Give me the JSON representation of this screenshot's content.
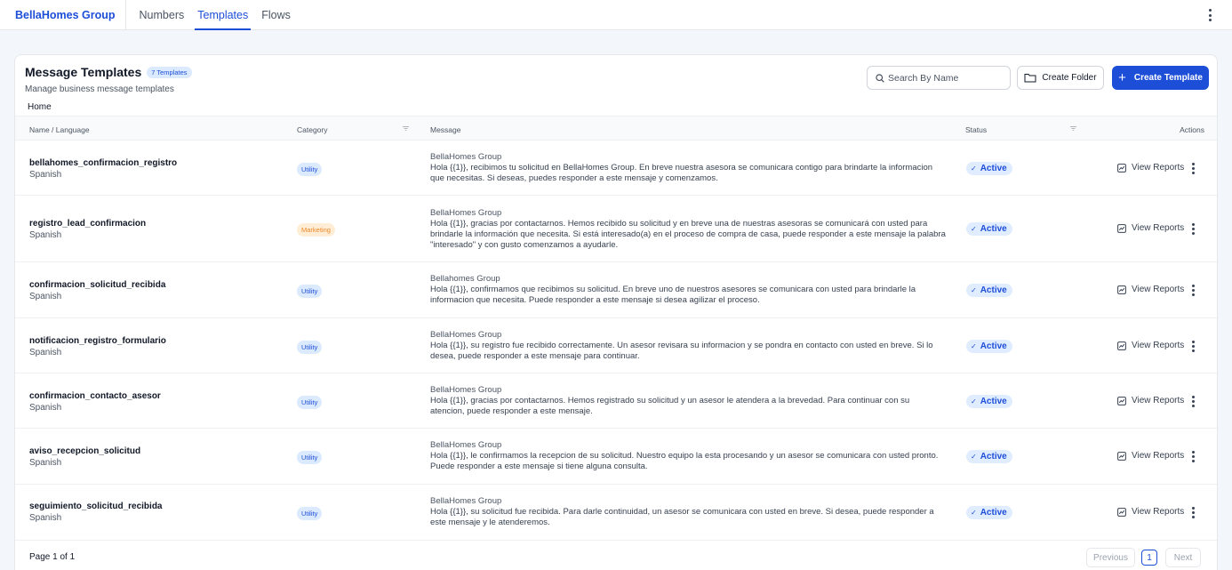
{
  "topbar": {
    "brand": "BellaHomes Group",
    "tabs": [
      {
        "label": "Numbers",
        "active": false
      },
      {
        "label": "Templates",
        "active": true
      },
      {
        "label": "Flows",
        "active": false
      }
    ]
  },
  "header": {
    "title": "Message Templates",
    "count_badge": "7 Templates",
    "subtitle": "Manage business message templates",
    "breadcrumb": "Home",
    "search_placeholder": "Search By Name",
    "create_folder_label": "Create Folder",
    "create_template_label": "Create Template"
  },
  "table": {
    "columns": {
      "name": "Name / Language",
      "category": "Category",
      "message": "Message",
      "status": "Status",
      "actions": "Actions"
    },
    "action_label": "View Reports",
    "rows": [
      {
        "name": "bellahomes_confirmacion_registro",
        "language": "Spanish",
        "category": "Utility",
        "sender": "BellaHomes Group",
        "body": "Hola {{1}}, recibimos tu solicitud en BellaHomes Group. En breve nuestra asesora se comunicara contigo para brindarte la informacion que necesitas. Si deseas, puedes responder a este mensaje y comenzamos.",
        "status": "Active"
      },
      {
        "name": "registro_lead_confirmacion",
        "language": "Spanish",
        "category": "Marketing",
        "sender": "BellaHomes Group",
        "body": "Hola {{1}}, gracias por contactarnos. Hemos recibido su solicitud y en breve una de nuestras asesoras se comunicará con usted para brindarle la información que necesita. Si está interesado(a) en el proceso de compra de casa, puede responder a este mensaje la palabra \"interesado\" y con gusto comenzamos a ayudarle.",
        "status": "Active"
      },
      {
        "name": "confirmacion_solicitud_recibida",
        "language": "Spanish",
        "category": "Utility",
        "sender": "Bellahomes Group",
        "body": "Hola {{1}}, confirmamos que recibimos su solicitud. En breve uno de nuestros asesores se comunicara con usted para brindarle la informacion que necesita. Puede responder a este mensaje si desea agilizar el proceso.",
        "status": "Active"
      },
      {
        "name": "notificacion_registro_formulario",
        "language": "Spanish",
        "category": "Utility",
        "sender": "BellaHomes Group",
        "body": "Hola {{1}}, su registro fue recibido correctamente. Un asesor revisara su informacion y se pondra en contacto con usted en breve. Si lo desea, puede responder a este mensaje para continuar.",
        "status": "Active"
      },
      {
        "name": "confirmacion_contacto_asesor",
        "language": "Spanish",
        "category": "Utility",
        "sender": "BellaHomes Group",
        "body": "Hola {{1}}, gracias por contactarnos. Hemos registrado su solicitud y un asesor le atendera a la brevedad. Para continuar con su atencion, puede responder a este mensaje.",
        "status": "Active"
      },
      {
        "name": "aviso_recepcion_solicitud",
        "language": "Spanish",
        "category": "Utility",
        "sender": "BellaHomes Group",
        "body": "Hola {{1}}, le confirmamos la recepcion de su solicitud. Nuestro equipo la esta procesando y un asesor se comunicara con usted pronto. Puede responder a este mensaje si tiene alguna consulta.",
        "status": "Active"
      },
      {
        "name": "seguimiento_solicitud_recibida",
        "language": "Spanish",
        "category": "Utility",
        "sender": "BellaHomes Group",
        "body": "Hola {{1}}, su solicitud fue recibida. Para darle continuidad, un asesor se comunicara con usted en breve. Si desea, puede responder a este mensaje y le atenderemos.",
        "status": "Active"
      }
    ]
  },
  "pagination": {
    "info": "Page 1 of 1",
    "previous": "Previous",
    "current": "1",
    "next": "Next"
  },
  "colors": {
    "accent": "#1d4ed8",
    "utility_badge_bg": "#dbeafe",
    "marketing_badge_bg": "#ffedd5",
    "marketing_badge_text": "#ea8a2c"
  },
  "icons": {
    "search": "search-icon",
    "folder": "folder-icon",
    "plus": "plus-icon",
    "check": "check-icon",
    "reports": "chart-icon",
    "more": "kebab-icon",
    "filter": "filter-icon"
  }
}
